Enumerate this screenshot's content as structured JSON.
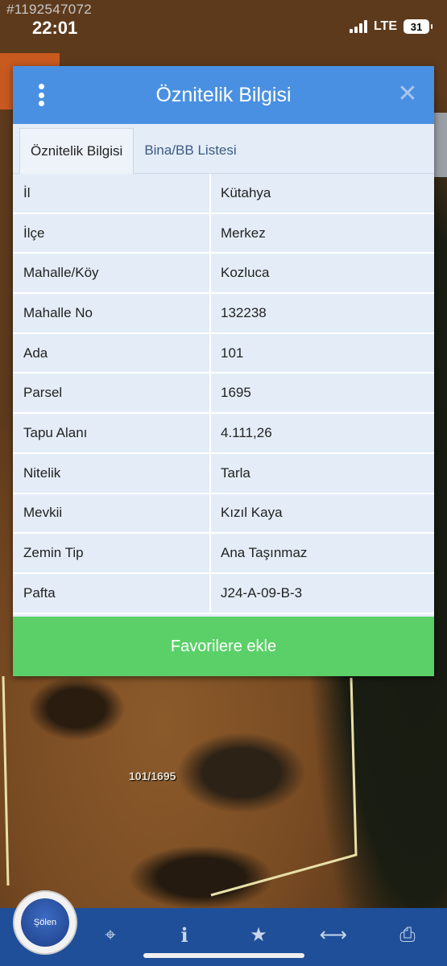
{
  "watermark_id": "#1192547072",
  "status": {
    "time": "22:01",
    "network": "LTE",
    "battery": "31"
  },
  "dialog": {
    "title": "Öznitelik Bilgisi",
    "tabs": [
      {
        "label": "Öznitelik Bilgisi",
        "active": true
      },
      {
        "label": "Bina/BB Listesi",
        "active": false
      }
    ],
    "rows": [
      {
        "key": "İl",
        "value": "Kütahya"
      },
      {
        "key": "İlçe",
        "value": "Merkez"
      },
      {
        "key": "Mahalle/Köy",
        "value": "Kozluca"
      },
      {
        "key": "Mahalle No",
        "value": "132238"
      },
      {
        "key": "Ada",
        "value": "101"
      },
      {
        "key": "Parsel",
        "value": "1695"
      },
      {
        "key": "Tapu Alanı",
        "value": "4.111,26"
      },
      {
        "key": "Nitelik",
        "value": "Tarla"
      },
      {
        "key": "Mevkii",
        "value": "Kızıl Kaya"
      },
      {
        "key": "Zemin Tip",
        "value": "Ana Taşınmaz"
      },
      {
        "key": "Pafta",
        "value": "J24-A-09-B-3"
      }
    ],
    "favorite_button": "Favorilere ekle"
  },
  "map": {
    "parcel_label": "101/1695"
  },
  "logo": {
    "text": "Şölen"
  },
  "toolbar": {
    "icons": [
      "locate-icon",
      "info-icon",
      "star-icon",
      "measure-icon",
      "print-icon"
    ]
  },
  "colors": {
    "header": "#4a90e2",
    "favorite": "#5bd068",
    "toolbar": "#1f4f99"
  }
}
